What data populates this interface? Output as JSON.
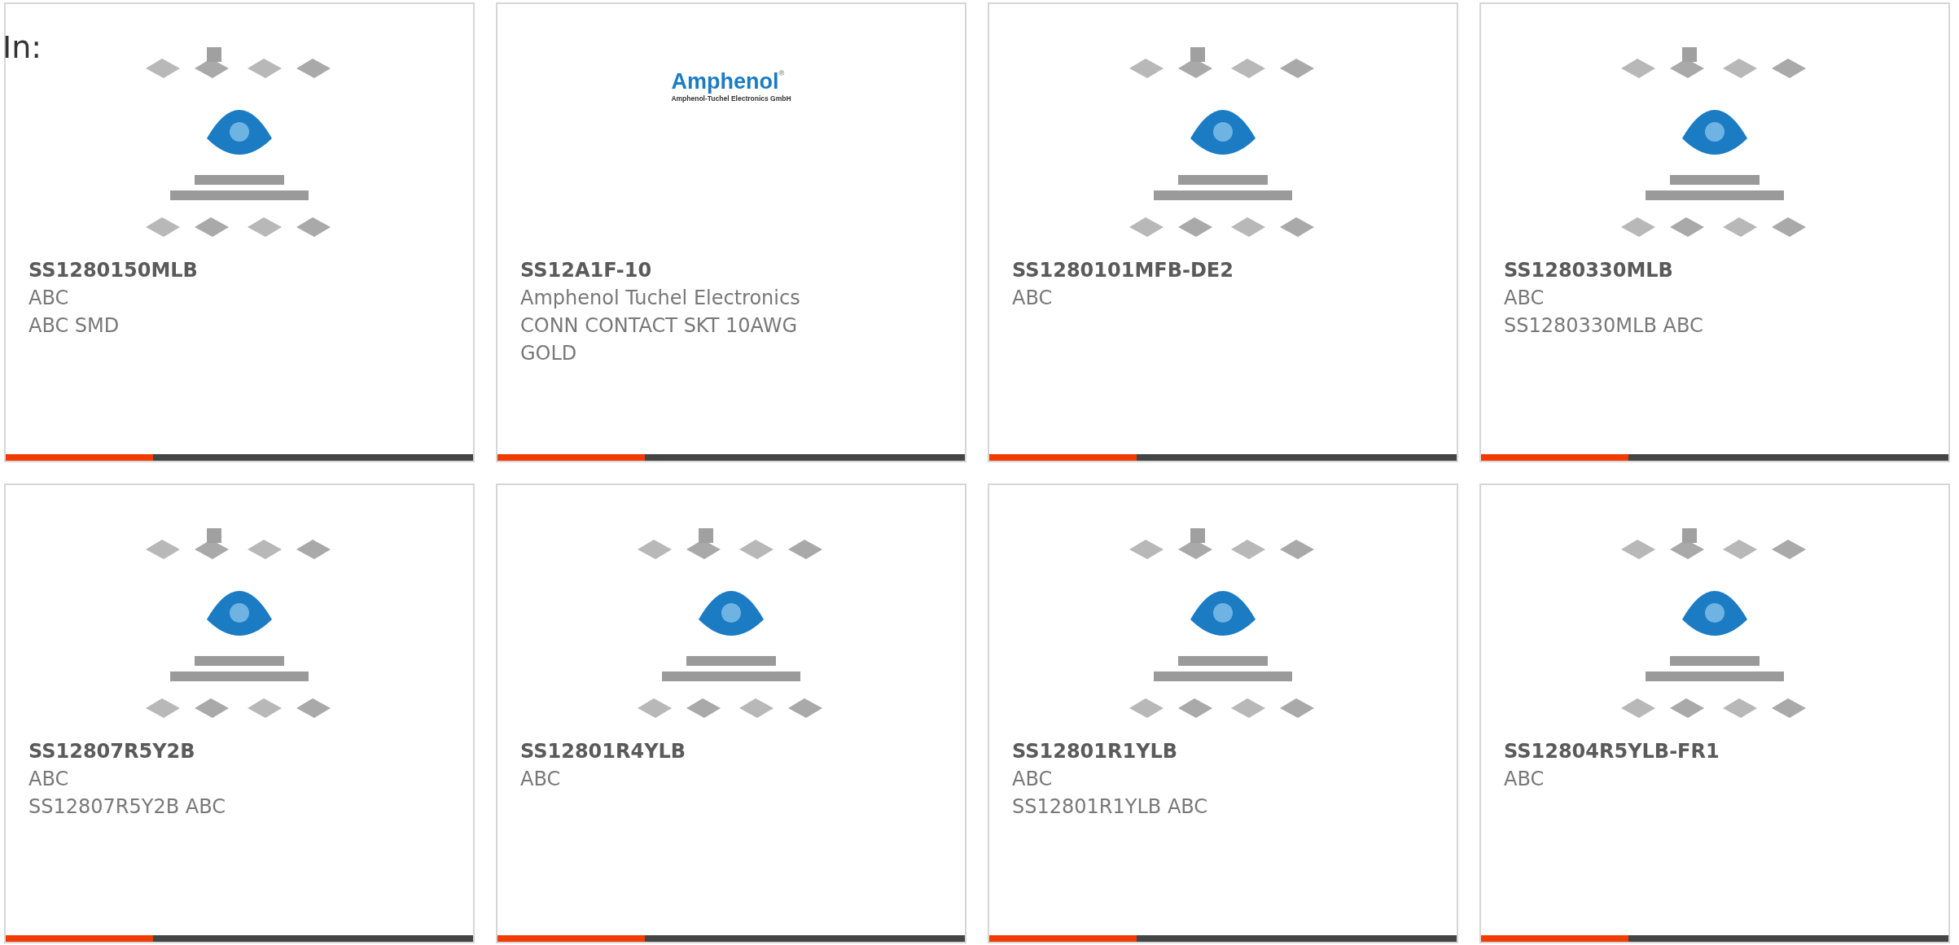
{
  "heading": "In:",
  "cards": [
    {
      "image": {
        "kind": "picture"
      },
      "title": "SS1280150MLB",
      "lines": [
        "ABC",
        "ABC SMD"
      ]
    },
    {
      "image": {
        "kind": "logo",
        "name": "Amphenol",
        "mark": "®",
        "subtitle": "Amphenol-Tuchel Electronics GmbH"
      },
      "title": "SS12A1F-10",
      "lines": [
        "Amphenol Tuchel Electronics",
        "CONN CONTACT SKT 10AWG GOLD"
      ]
    },
    {
      "image": {
        "kind": "picture"
      },
      "title": "SS1280101MFB-DE2",
      "lines": [
        "ABC"
      ]
    },
    {
      "image": {
        "kind": "picture"
      },
      "title": "SS1280330MLB",
      "lines": [
        "ABC",
        "SS1280330MLB ABC"
      ]
    },
    {
      "image": {
        "kind": "picture"
      },
      "title": "SS12807R5Y2B",
      "lines": [
        "ABC",
        "SS12807R5Y2B ABC"
      ]
    },
    {
      "image": {
        "kind": "picture"
      },
      "title": "SS12801R4YLB",
      "lines": [
        "ABC"
      ]
    },
    {
      "image": {
        "kind": "picture"
      },
      "title": "SS12801R1YLB",
      "lines": [
        "ABC",
        "SS12801R1YLB ABC"
      ]
    },
    {
      "image": {
        "kind": "picture"
      },
      "title": "SS12804R5YLB-FR1",
      "lines": [
        "ABC"
      ]
    }
  ]
}
